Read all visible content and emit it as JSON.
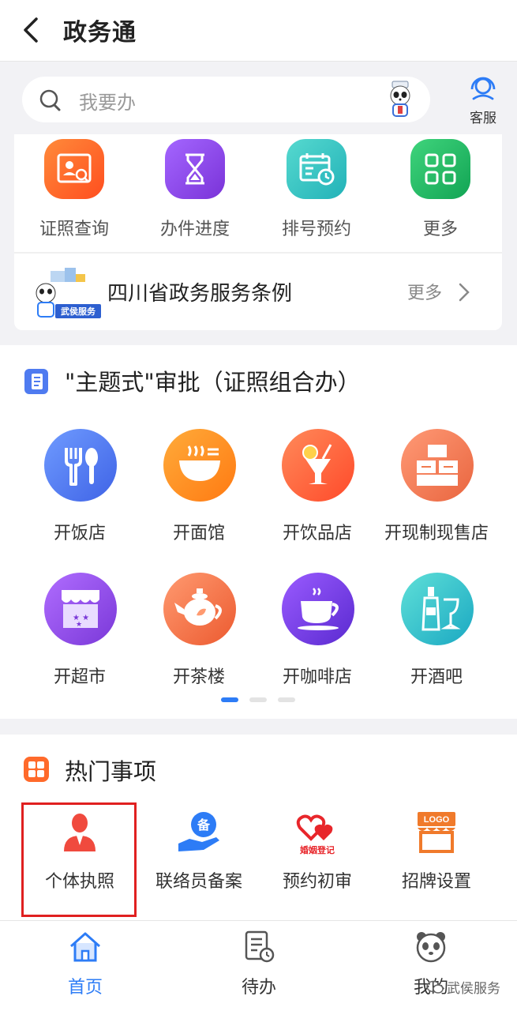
{
  "header": {
    "title": "政务通"
  },
  "search": {
    "placeholder": "我要办",
    "service_label": "客服"
  },
  "quick_actions": [
    {
      "label": "证照查询",
      "icon": "id-card-search-icon",
      "color": "#ff6a2b"
    },
    {
      "label": "办件进度",
      "icon": "hourglass-icon",
      "color": "#8a45e6"
    },
    {
      "label": "排号预约",
      "icon": "calendar-clock-icon",
      "color": "#2bc3c2"
    },
    {
      "label": "更多",
      "icon": "grid-more-icon",
      "color": "#1fb964"
    }
  ],
  "regulation": {
    "image_caption": "武侯服务",
    "title": "四川省政务服务条例",
    "more_label": "更多"
  },
  "theme_section": {
    "title": "\"主题式\"审批（证照组合办）",
    "items": [
      {
        "label": "开饭店",
        "icon": "fork-spoon-icon",
        "color": "#4d7df0"
      },
      {
        "label": "开面馆",
        "icon": "noodle-bowl-icon",
        "color": "#ff8c1a"
      },
      {
        "label": "开饮品店",
        "icon": "drink-cup-icon",
        "color": "#ff6a3a"
      },
      {
        "label": "开现制现售店",
        "icon": "boxes-icon",
        "color": "#f07a4e"
      },
      {
        "label": "开超市",
        "icon": "store-icon",
        "color": "#8d4fe0"
      },
      {
        "label": "开茶楼",
        "icon": "teapot-icon",
        "color": "#f2703f"
      },
      {
        "label": "开咖啡店",
        "icon": "coffee-cup-icon",
        "color": "#7a3fe0"
      },
      {
        "label": "开酒吧",
        "icon": "wine-bottle-icon",
        "color": "#26c2c6"
      }
    ],
    "pager": {
      "pages": 3,
      "active": 1
    }
  },
  "hot_section": {
    "title": "热门事项",
    "items": [
      {
        "label": "个体执照",
        "icon": "person-icon",
        "color": "#f04a3e",
        "highlighted": true
      },
      {
        "label": "联络员备案",
        "icon": "hand-badge-icon",
        "badge_text": "备",
        "color": "#2d7cf6"
      },
      {
        "label": "预约初审",
        "icon": "double-heart-icon",
        "badge_text": "婚姻登记",
        "color": "#e8262b"
      },
      {
        "label": "招牌设置",
        "icon": "signboard-icon",
        "badge_text": "LOGO",
        "color": "#f07a2b"
      }
    ]
  },
  "bottom_nav": [
    {
      "label": "首页",
      "icon": "home-icon",
      "active": true
    },
    {
      "label": "待办",
      "icon": "todo-doc-icon",
      "active": false
    },
    {
      "label": "我的",
      "icon": "panda-face-icon",
      "active": false
    }
  ],
  "watermark": {
    "text": "武侯服务"
  },
  "colors": {
    "accent": "#2d7cf6",
    "highlight": "#e02020",
    "background": "#f2f2f5"
  }
}
